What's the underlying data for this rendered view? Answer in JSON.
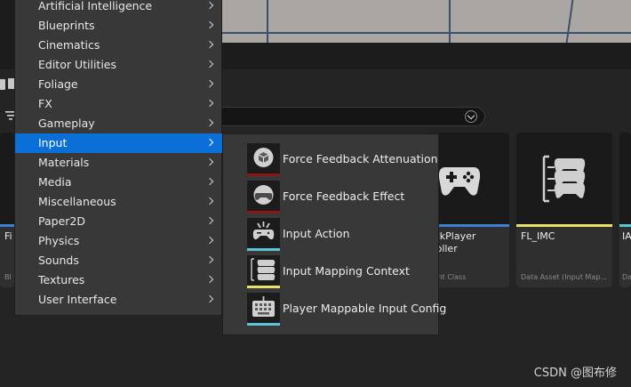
{
  "category_menu": {
    "items": [
      {
        "label": "Artificial Intelligence"
      },
      {
        "label": "Blueprints"
      },
      {
        "label": "Cinematics"
      },
      {
        "label": "Editor Utilities"
      },
      {
        "label": "Foliage"
      },
      {
        "label": "FX"
      },
      {
        "label": "Gameplay"
      },
      {
        "label": "Input",
        "active": true
      },
      {
        "label": "Materials"
      },
      {
        "label": "Media"
      },
      {
        "label": "Miscellaneous"
      },
      {
        "label": "Paper2D"
      },
      {
        "label": "Physics"
      },
      {
        "label": "Sounds"
      },
      {
        "label": "Textures"
      },
      {
        "label": "User Interface"
      }
    ]
  },
  "input_submenu": {
    "items": [
      {
        "label": "Force Feedback Attenuation",
        "icon": "force-feedback-attenuation-icon",
        "stripe": "#8a1616"
      },
      {
        "label": "Force Feedback Effect",
        "icon": "force-feedback-effect-icon",
        "stripe": "#8a1616"
      },
      {
        "label": "Input Action",
        "icon": "input-action-icon",
        "stripe": "#58c6d6"
      },
      {
        "label": "Input Mapping Context",
        "icon": "input-mapping-context-icon",
        "stripe": "#e8e26a"
      },
      {
        "label": "Player Mappable Input Config",
        "icon": "player-mappable-input-config-icon",
        "stripe": "#58c6d6"
      }
    ]
  },
  "assets": [
    {
      "name": "Fi",
      "type": "Bl",
      "bar_color": "#3f7fd6"
    },
    {
      "name": "ockPlayer",
      "name2": "troller",
      "type": "print Class",
      "bar_color": "#3f7fd6"
    },
    {
      "name": "FL_IMC",
      "type": "Data Asset (Input Map...",
      "bar_color": "#e8e26a"
    },
    {
      "name": "IA",
      "type": "Da",
      "bar_color": "#58c6d6"
    }
  ],
  "watermark": "CSDN @图布修"
}
